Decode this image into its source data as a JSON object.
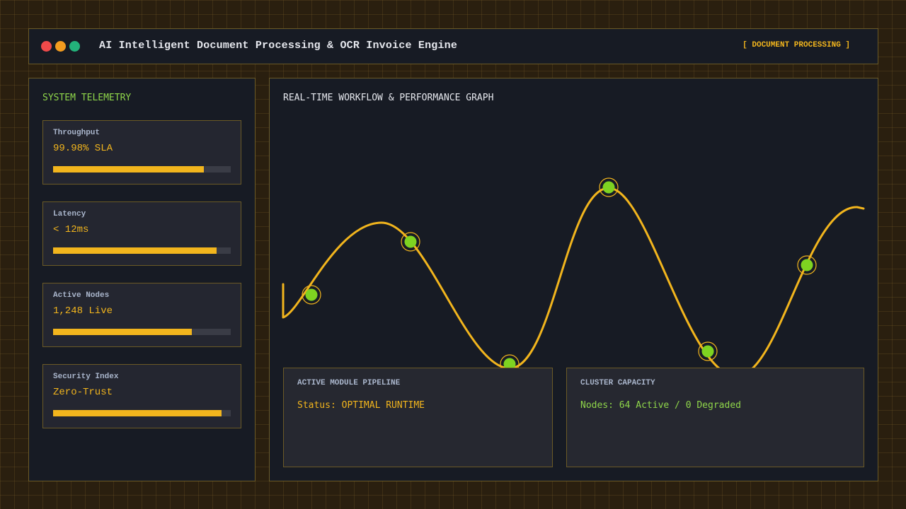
{
  "colors": {
    "accent": "#f2b51d",
    "green": "#7ed321",
    "title_green": "#8fd64a",
    "muted_label": "#aab6cc",
    "dot_red": "#ef4a4a",
    "dot_orange": "#f39c1f",
    "dot_green": "#23b27a"
  },
  "header": {
    "title": "AI Intelligent Document Processing & OCR Invoice Engine",
    "badge": "[ DOCUMENT PROCESSING ]",
    "window_controls": [
      "close-dot",
      "minimize-dot",
      "maximize-dot"
    ]
  },
  "sidebar": {
    "title": "SYSTEM TELEMETRY",
    "metrics": [
      {
        "label": "Throughput",
        "value": "99.98% SLA",
        "fill": 0.85
      },
      {
        "label": "Latency",
        "value": "< 12ms",
        "fill": 0.92
      },
      {
        "label": "Active Nodes",
        "value": "1,248 Live",
        "fill": 0.78
      },
      {
        "label": "Security Index",
        "value": "Zero-Trust",
        "fill": 0.95
      }
    ]
  },
  "main": {
    "title": "REAL-TIME WORKFLOW & PERFORMANCE GRAPH",
    "pipeline": {
      "title": "ACTIVE MODULE PIPELINE",
      "status": "Status: OPTIMAL RUNTIME"
    },
    "capacity": {
      "title": "CLUSTER CAPACITY",
      "nodes": "Nodes: 64 Active / 0 Degraded"
    }
  }
}
